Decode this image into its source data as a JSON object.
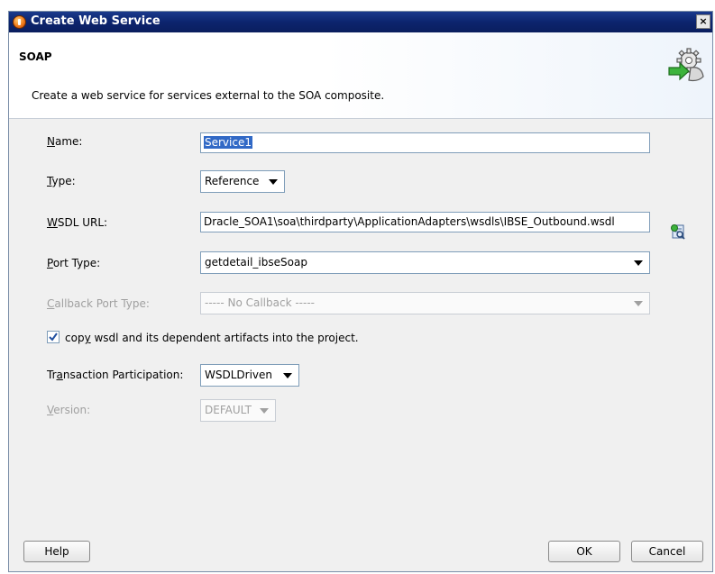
{
  "window": {
    "title": "Create Web Service",
    "close_label": "×"
  },
  "banner": {
    "title": "SOAP",
    "description": "Create a web service for services external to the SOA composite."
  },
  "form": {
    "name": {
      "label": "Name:",
      "value": "Service1"
    },
    "type": {
      "label": "Type:",
      "value": "Reference"
    },
    "wsdl_url": {
      "label": "WSDL URL:",
      "value": "Dracle_SOA1\\soa\\thirdparty\\ApplicationAdapters\\wsdls\\IBSE_Outbound.wsdl"
    },
    "port_type": {
      "label": "Port Type:",
      "value": "getdetail_ibseSoap"
    },
    "callback_port_type": {
      "label": "Callback Port Type:",
      "value": "----- No Callback -----"
    },
    "copy_wsdl": {
      "label": "copy wsdl and its dependent artifacts into the project.",
      "checked": true
    },
    "transaction_participation": {
      "label": "Transaction Participation:",
      "value": "WSDLDriven"
    },
    "version": {
      "label": "Version:",
      "value": "DEFAULT"
    }
  },
  "buttons": {
    "help": "Help",
    "ok": "OK",
    "cancel": "Cancel"
  },
  "colors": {
    "title_bar": "#0c246e",
    "selection": "#3169c6",
    "disabled_text": "#a0a0a0"
  }
}
